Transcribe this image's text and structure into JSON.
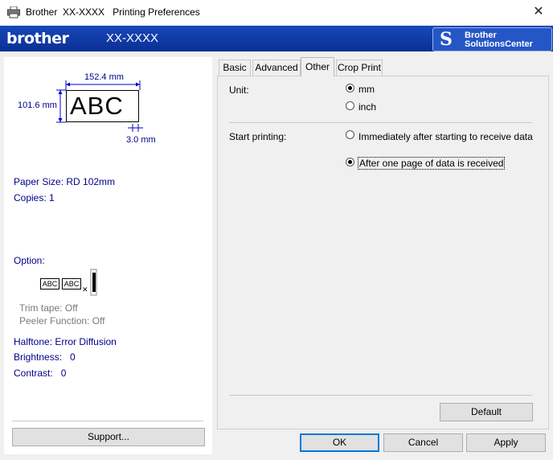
{
  "window": {
    "title_app": "Brother",
    "title_model": "XX-XXXX",
    "title_suffix": "Printing Preferences",
    "close_glyph": "✕"
  },
  "header": {
    "logo": "brother",
    "model": "XX-XXXX",
    "solutions_line1": "Brother",
    "solutions_line2": "SolutionsCenter"
  },
  "preview": {
    "width_label": "152.4 mm",
    "height_label": "101.6 mm",
    "sample_text": "ABC",
    "margin_label": "3.0 mm",
    "paper_size": "Paper Size: RD 102mm",
    "copies": "Copies: 1",
    "option_label": "Option:",
    "mini_abc_1": "ABC",
    "mini_abc_2": "ABC",
    "trim_tape": "Trim tape: Off",
    "peeler": "Peeler Function: Off",
    "halftone": "Halftone: Error Diffusion",
    "brightness": "Brightness:   0",
    "contrast": "Contrast:   0",
    "support_button": "Support..."
  },
  "tabs": [
    {
      "label": "Basic",
      "active": false
    },
    {
      "label": "Advanced",
      "active": false
    },
    {
      "label": "Other",
      "active": true
    },
    {
      "label": "Crop Print",
      "active": false
    }
  ],
  "other_tab": {
    "unit_label": "Unit:",
    "unit_options": [
      {
        "label": "mm",
        "selected": true
      },
      {
        "label": "inch",
        "selected": false
      }
    ],
    "start_label": "Start printing:",
    "start_options": [
      {
        "label": "Immediately after starting to receive data",
        "selected": false
      },
      {
        "label": "After one page of data is received",
        "selected": true
      }
    ],
    "default_button": "Default"
  },
  "footer": {
    "ok": "OK",
    "cancel": "Cancel",
    "apply": "Apply"
  }
}
